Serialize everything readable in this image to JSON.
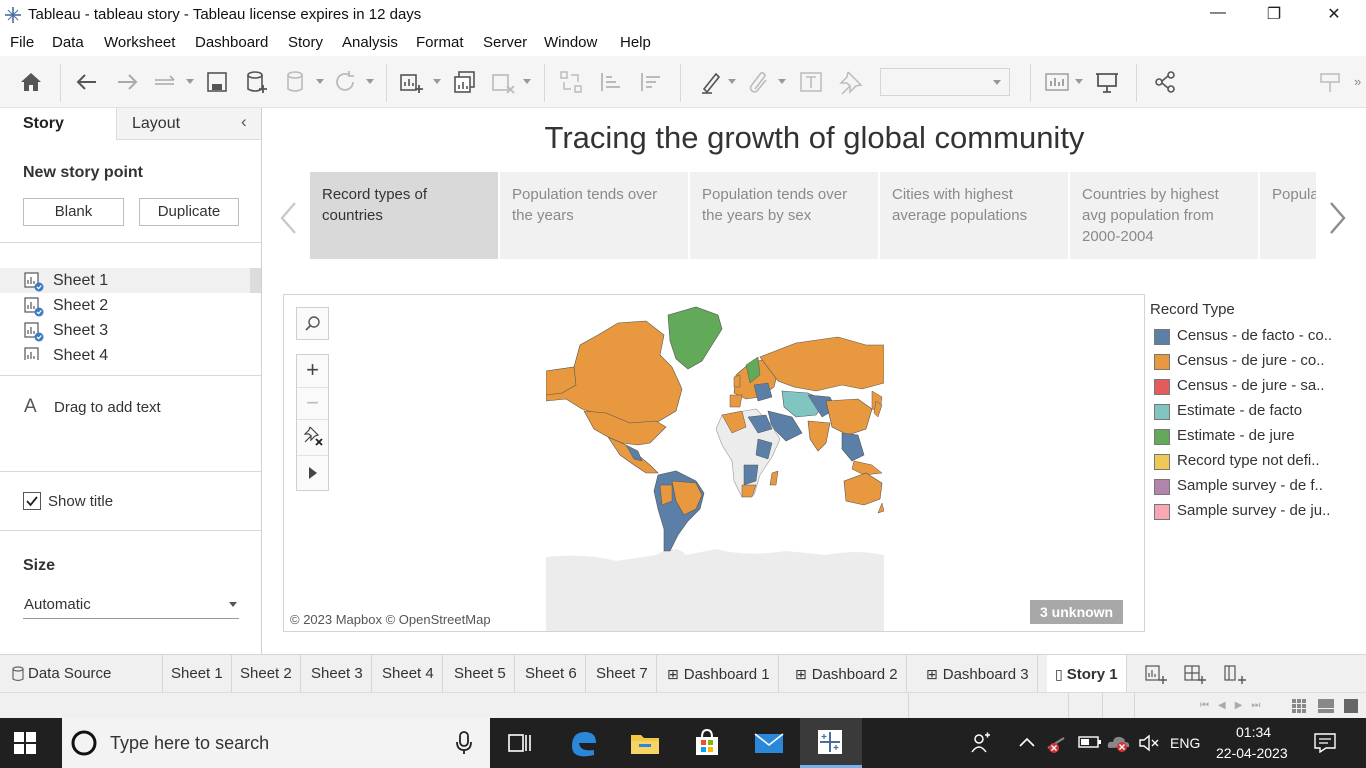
{
  "window": {
    "title": "Tableau - tableau story - Tableau license expires in 12 days",
    "minimize": "—",
    "maximize": "❐",
    "close": "✕"
  },
  "menu": [
    "File",
    "Data",
    "Worksheet",
    "Dashboard",
    "Story",
    "Analysis",
    "Format",
    "Server",
    "Window",
    "Help"
  ],
  "left_pane": {
    "tabs": {
      "story": "Story",
      "layout": "Layout"
    },
    "new_story_point": "New story point",
    "blank_button": "Blank",
    "duplicate_button": "Duplicate",
    "sheets": [
      "Sheet 1",
      "Sheet 2",
      "Sheet 3",
      "Sheet 4"
    ],
    "drag_text": "Drag to add text",
    "show_title": "Show title",
    "size_label": "Size",
    "size_value": "Automatic"
  },
  "story": {
    "title": "Tracing the growth of global community",
    "points": [
      "Record types of countries",
      "Population tends over the years",
      "Population tends over the years by sex",
      "Cities with highest average populations",
      "Countries by highest avg population from 2000-2004",
      "Popula"
    ]
  },
  "map": {
    "attribution": "© 2023 Mapbox © OpenStreetMap",
    "unknown_badge": "3 unknown"
  },
  "legend": {
    "title": "Record Type",
    "items": [
      {
        "label": "Census - de facto - co..",
        "color": "#5b7fa6"
      },
      {
        "label": "Census - de jure - co..",
        "color": "#e8993f"
      },
      {
        "label": "Census - de jure - sa..",
        "color": "#e35b5b"
      },
      {
        "label": "Estimate - de facto",
        "color": "#80c5c2"
      },
      {
        "label": "Estimate - de jure",
        "color": "#63a95a"
      },
      {
        "label": "Record type not defi..",
        "color": "#eec957"
      },
      {
        "label": "Sample survey - de f..",
        "color": "#b084ab"
      },
      {
        "label": "Sample survey - de ju..",
        "color": "#f9a8b3"
      }
    ]
  },
  "bottom_tabs": [
    "Data Source",
    "Sheet 1",
    "Sheet 2",
    "Sheet 3",
    "Sheet 4",
    "Sheet 5",
    "Sheet 6",
    "Sheet 7",
    "Dashboard 1",
    "Dashboard 2",
    "Dashboard 3",
    "Story 1"
  ],
  "taskbar": {
    "search_placeholder": "Type here to search",
    "language": "ENG",
    "time": "01:34",
    "date": "22-04-2023"
  }
}
